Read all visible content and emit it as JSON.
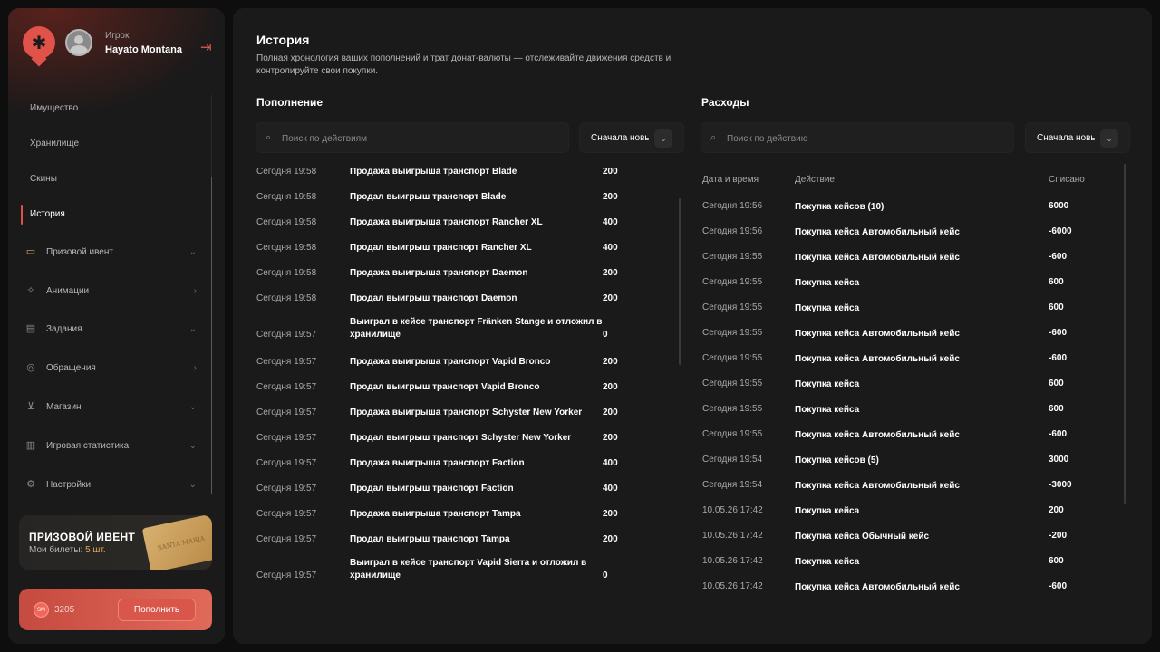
{
  "profile": {
    "role": "Игрок",
    "name": "Hayato Montana"
  },
  "nav": {
    "sub_items": [
      "Имущество",
      "Хранилище",
      "Скины",
      "История"
    ],
    "main_items": [
      {
        "label": "Призовой ивент",
        "icon": "ticket-icon",
        "chevron": "down"
      },
      {
        "label": "Анимации",
        "icon": "dance-icon",
        "chevron": "right"
      },
      {
        "label": "Задания",
        "icon": "clipboard-icon",
        "chevron": "down"
      },
      {
        "label": "Обращения",
        "icon": "lifebuoy-icon",
        "chevron": "right"
      },
      {
        "label": "Магазин",
        "icon": "cart-icon",
        "chevron": "down"
      },
      {
        "label": "Игровая статистика",
        "icon": "chart-icon",
        "chevron": "down"
      },
      {
        "label": "Настройки",
        "icon": "gear-icon",
        "chevron": "down"
      }
    ]
  },
  "event": {
    "title": "ПРИЗОВОЙ ИВЕНТ",
    "tickets_label": "Мои билеты:",
    "tickets_value": "5 шт.",
    "ticket_text": "SANTA MARIA"
  },
  "balance": {
    "coin": "SM",
    "value": "3205",
    "topup_label": "Пополнить"
  },
  "page": {
    "title": "История",
    "description": "Полная хронология ваших пополнений и трат донат-валюты — отслеживайте движения средств и контролируйте свои покупки."
  },
  "income": {
    "title": "Пополнение",
    "search_placeholder": "Поиск по действиям",
    "sort_label": "Сначала новые",
    "rows": [
      {
        "time": "Сегодня 19:58",
        "action": "Продажа выигрыша транспорт Blade",
        "value": "200"
      },
      {
        "time": "Сегодня 19:58",
        "action": "Продал выигрыш транспорт Blade",
        "value": "200"
      },
      {
        "time": "Сегодня 19:58",
        "action": "Продажа выигрыша транспорт Rancher XL",
        "value": "400"
      },
      {
        "time": "Сегодня 19:58",
        "action": "Продал выигрыш транспорт Rancher XL",
        "value": "400"
      },
      {
        "time": "Сегодня 19:58",
        "action": "Продажа выигрыша транспорт Daemon",
        "value": "200"
      },
      {
        "time": "Сегодня 19:58",
        "action": "Продал выигрыш транспорт Daemon",
        "value": "200"
      },
      {
        "time": "Сегодня 19:57",
        "action": "Выиграл в кейсе транспорт Fränken Stange и отложил в хранилище",
        "value": "0"
      },
      {
        "time": "Сегодня 19:57",
        "action": "Продажа выигрыша транспорт Vapid Bronco",
        "value": "200"
      },
      {
        "time": "Сегодня 19:57",
        "action": "Продал выигрыш транспорт Vapid Bronco",
        "value": "200"
      },
      {
        "time": "Сегодня 19:57",
        "action": "Продажа выигрыша транспорт Schyster New Yorker",
        "value": "200"
      },
      {
        "time": "Сегодня 19:57",
        "action": "Продал выигрыш транспорт Schyster New Yorker",
        "value": "200"
      },
      {
        "time": "Сегодня 19:57",
        "action": "Продажа выигрыша транспорт Faction",
        "value": "400"
      },
      {
        "time": "Сегодня 19:57",
        "action": "Продал выигрыш транспорт Faction",
        "value": "400"
      },
      {
        "time": "Сегодня 19:57",
        "action": "Продажа выигрыша транспорт Tampa",
        "value": "200"
      },
      {
        "time": "Сегодня 19:57",
        "action": "Продал выигрыш транспорт Tampa",
        "value": "200"
      },
      {
        "time": "Сегодня 19:57",
        "action": "Выиграл в кейсе транспорт Vapid Sierra и отложил в хранилище",
        "value": "0"
      }
    ]
  },
  "expenses": {
    "title": "Расходы",
    "search_placeholder": "Поиск по действию",
    "sort_label": "Сначала новые",
    "columns": [
      "Дата и время",
      "Действие",
      "Списано"
    ],
    "rows": [
      {
        "time": "Сегодня 19:56",
        "action": "Покупка кейсов (10)",
        "value": "6000"
      },
      {
        "time": "Сегодня 19:56",
        "action": "Покупка кейса Автомобильный кейс",
        "value": "-6000"
      },
      {
        "time": "Сегодня 19:55",
        "action": "Покупка кейса Автомобильный кейс",
        "value": "-600"
      },
      {
        "time": "Сегодня 19:55",
        "action": "Покупка кейса",
        "value": "600"
      },
      {
        "time": "Сегодня 19:55",
        "action": "Покупка кейса",
        "value": "600"
      },
      {
        "time": "Сегодня 19:55",
        "action": "Покупка кейса Автомобильный кейс",
        "value": "-600"
      },
      {
        "time": "Сегодня 19:55",
        "action": "Покупка кейса Автомобильный кейс",
        "value": "-600"
      },
      {
        "time": "Сегодня 19:55",
        "action": "Покупка кейса",
        "value": "600"
      },
      {
        "time": "Сегодня 19:55",
        "action": "Покупка кейса",
        "value": "600"
      },
      {
        "time": "Сегодня 19:55",
        "action": "Покупка кейса Автомобильный кейс",
        "value": "-600"
      },
      {
        "time": "Сегодня 19:54",
        "action": "Покупка кейсов (5)",
        "value": "3000"
      },
      {
        "time": "Сегодня 19:54",
        "action": "Покупка кейса Автомобильный кейс",
        "value": "-3000"
      },
      {
        "time": "10.05.26 17:42",
        "action": "Покупка кейса",
        "value": "200"
      },
      {
        "time": "10.05.26 17:42",
        "action": "Покупка кейса Обычный кейс",
        "value": "-200"
      },
      {
        "time": "10.05.26 17:42",
        "action": "Покупка кейса",
        "value": "600"
      },
      {
        "time": "10.05.26 17:42",
        "action": "Покупка кейса Автомобильный кейс",
        "value": "-600"
      }
    ]
  }
}
